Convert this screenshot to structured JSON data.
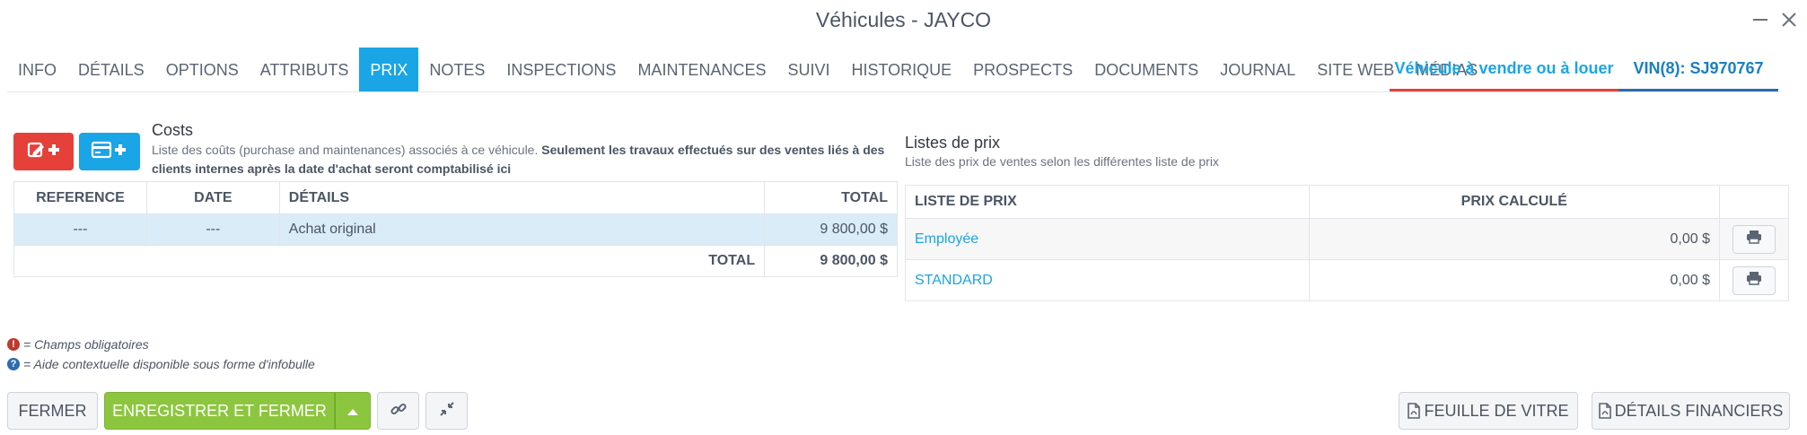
{
  "window": {
    "title": "Véhicules - JAYCO"
  },
  "tabs": [
    {
      "label": "INFO"
    },
    {
      "label": "DÉTAILS"
    },
    {
      "label": "OPTIONS"
    },
    {
      "label": "ATTRIBUTS"
    },
    {
      "label": "PRIX",
      "active": true
    },
    {
      "label": "NOTES"
    },
    {
      "label": "INSPECTIONS"
    },
    {
      "label": "MAINTENANCES"
    },
    {
      "label": "SUIVI"
    },
    {
      "label": "HISTORIQUE"
    },
    {
      "label": "PROSPECTS"
    },
    {
      "label": "DOCUMENTS"
    },
    {
      "label": "JOURNAL"
    },
    {
      "label": "SITE WEB"
    },
    {
      "label": "MÉDIAS"
    }
  ],
  "status_tabs": {
    "sale": "Véhicule à vendre ou à louer",
    "vin": "VIN(8): SJ970767"
  },
  "costs": {
    "title": "Costs",
    "desc_normal": "Liste des coûts (purchase and maintenances) associés à ce véhicule. ",
    "desc_bold": "Seulement les travaux effectués sur des ventes liés à des clients internes après la date d'achat seront comptabilisé ici",
    "headers": {
      "reference": "REFERENCE",
      "date": "DATE",
      "details": "DÉTAILS",
      "total": "TOTAL"
    },
    "rows": [
      {
        "reference": "---",
        "date": "---",
        "details": "Achat original",
        "total": "9 800,00 $"
      }
    ],
    "footer": {
      "label": "TOTAL",
      "value": "9 800,00 $"
    }
  },
  "prices": {
    "title": "Listes de prix",
    "desc": "Liste des prix de ventes selon les différentes liste de prix",
    "headers": {
      "list": "LISTE DE PRIX",
      "computed": "PRIX CALCULÉ"
    },
    "rows": [
      {
        "name": "Employée",
        "price": "0,00 $"
      },
      {
        "name": "STANDARD",
        "price": "0,00 $"
      }
    ]
  },
  "legend": {
    "required": "= Champs obligatoires",
    "help": "= Aide contextuelle disponible sous forme d'infobulle"
  },
  "footer": {
    "close": "FERMER",
    "save_close": "ENREGISTRER ET FERMER",
    "window_sticker": "FEUILLE DE VITRE",
    "financial_details": "DÉTAILS FINANCIERS"
  },
  "colors": {
    "accent_blue": "#1aa5e6",
    "danger_red": "#e5403a",
    "success_green": "#8cc63f",
    "vin_blue": "#2b6cb0"
  },
  "icons": {
    "add_cost": "edit-plus-icon",
    "add_payment": "credit-card-plus-icon",
    "print": "print-icon",
    "link": "link-icon",
    "collapse": "compress-icon",
    "pdf": "pdf-file-icon",
    "required": "exclamation-circle-icon",
    "help": "question-circle-icon"
  }
}
